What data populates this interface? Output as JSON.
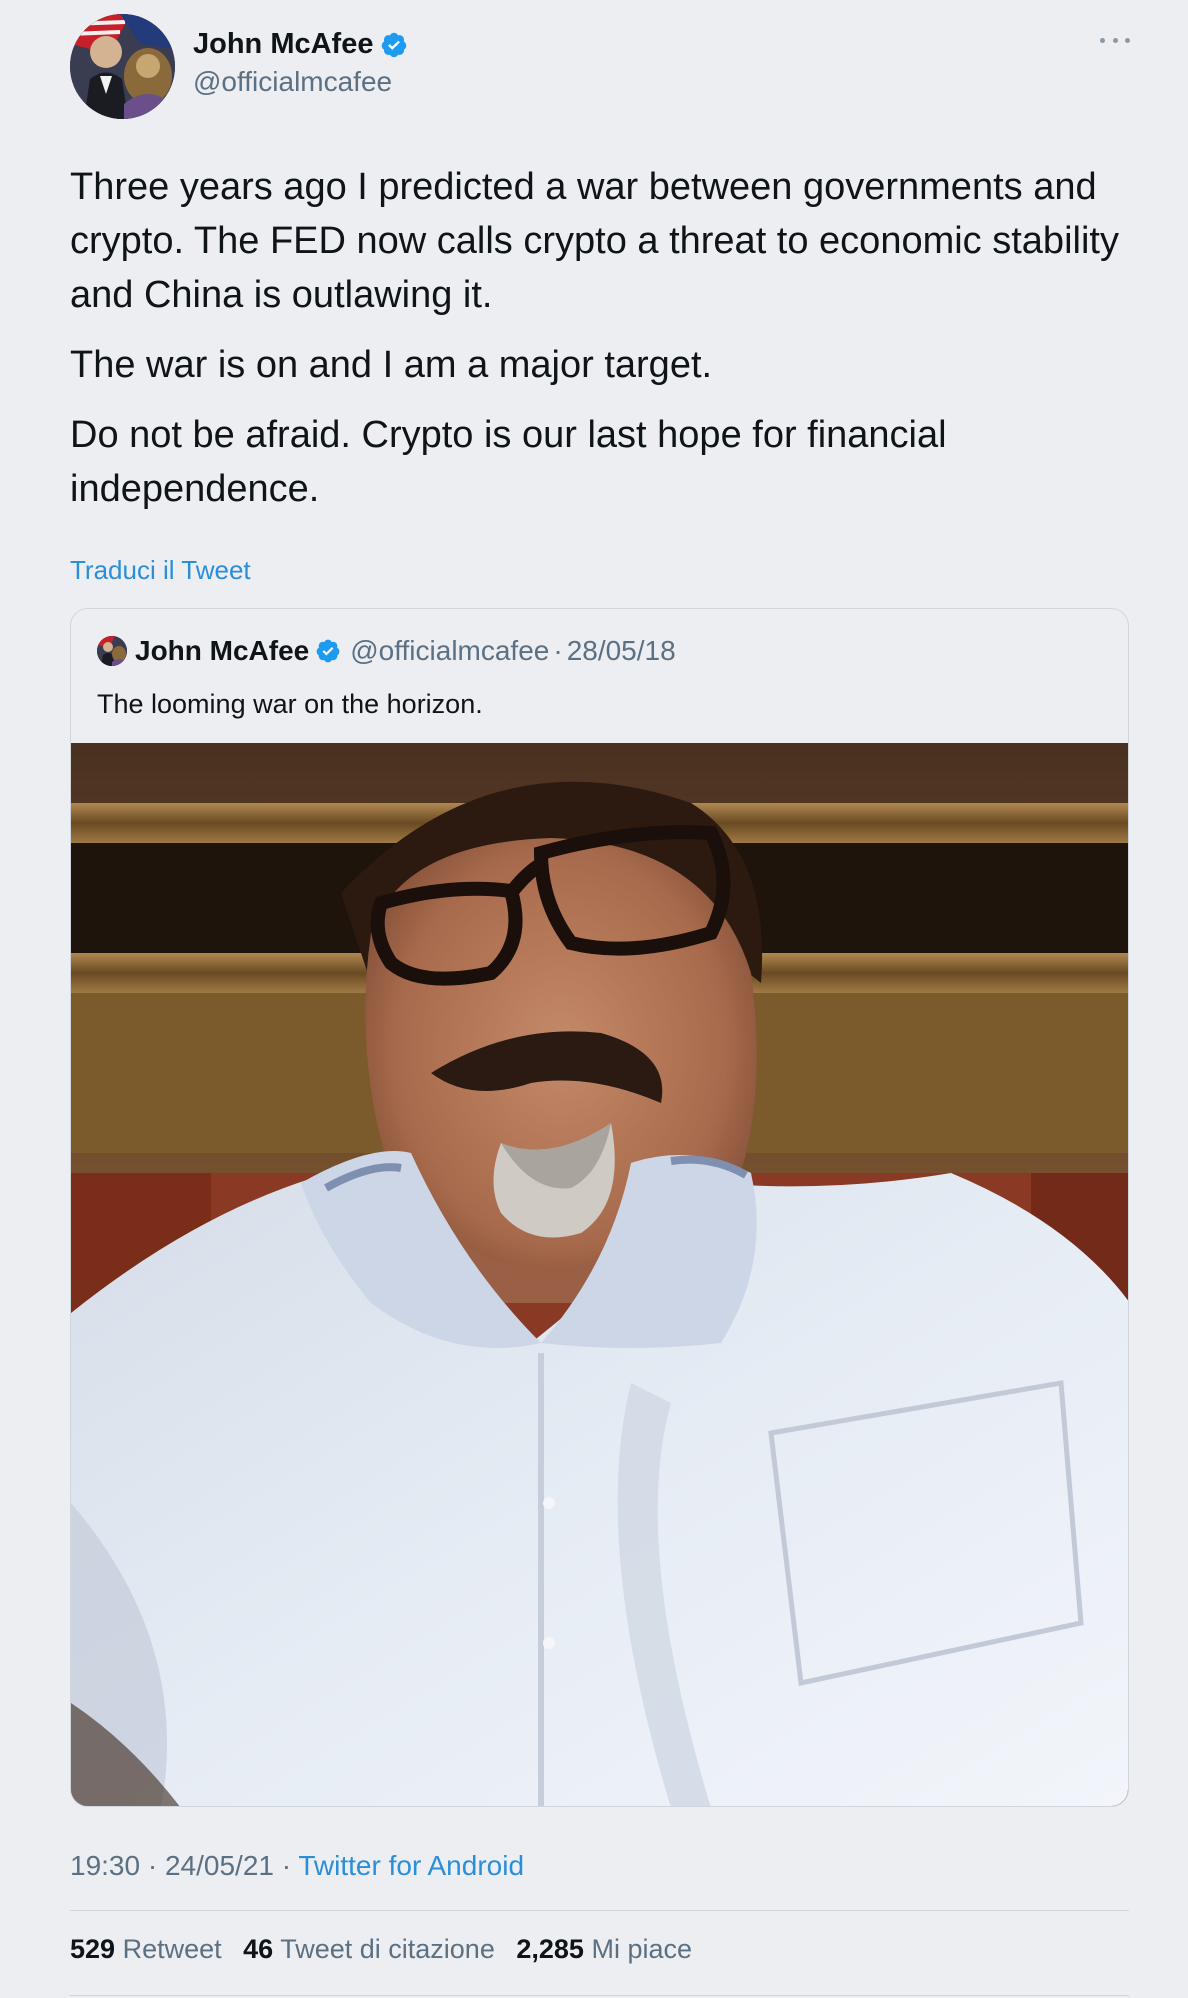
{
  "author": {
    "name": "John McAfee",
    "handle": "@officialmcafee",
    "verified": true
  },
  "tweet": {
    "paragraphs": [
      "Three years ago I predicted a war between governments and crypto. The FED now calls crypto a threat to economic stability and China is outlawing it.",
      "The war is on and I am a major target.",
      "Do not be afraid. Crypto is our last hope for financial independence."
    ],
    "translate_label": "Traduci il Tweet"
  },
  "quote": {
    "name": "John McAfee",
    "handle": "@officialmcafee",
    "separator": "·",
    "date": "28/05/18",
    "text": "The looming war on the horizon."
  },
  "meta": {
    "time": "19:30",
    "separator": "·",
    "date": "24/05/21",
    "source": "Twitter for Android"
  },
  "stats": {
    "retweets_count": "529",
    "retweets_label": "Retweet",
    "quotes_count": "46",
    "quotes_label": "Tweet di citazione",
    "likes_count": "2,285",
    "likes_label": "Mi piace"
  },
  "colors": {
    "background": "#eceef2",
    "accent": "#2b8ed8",
    "verified": "#1d9bf0",
    "secondary_text": "#5b7083"
  },
  "icons": [
    "verified-badge-icon",
    "more-options-icon"
  ]
}
